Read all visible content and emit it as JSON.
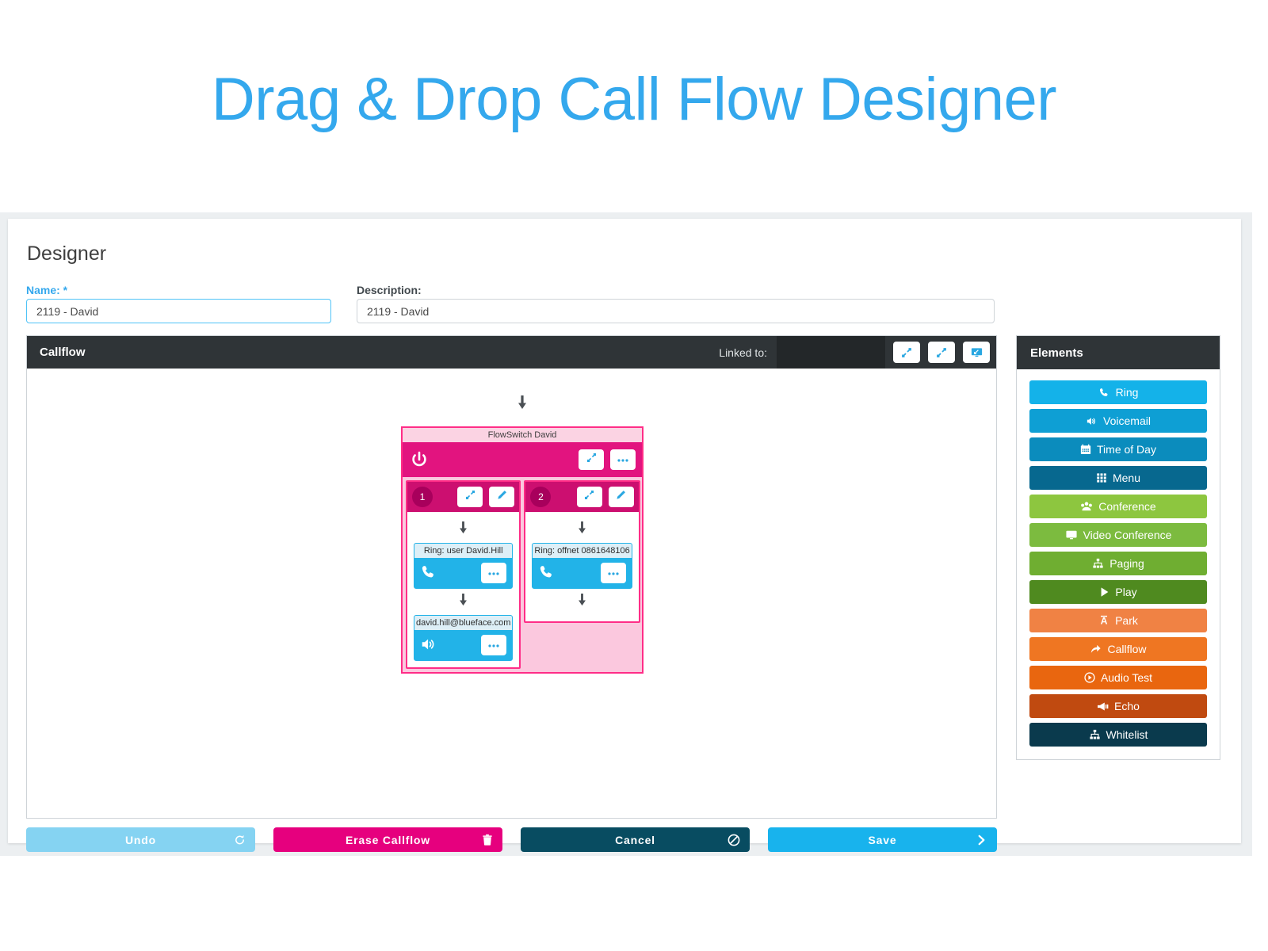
{
  "page": {
    "title": "Drag & Drop Call Flow Designer",
    "title_color": "#34a8ed"
  },
  "designer": {
    "heading": "Designer",
    "name_label": "Name: *",
    "name_value": "2119 - David",
    "name_placeholder": "Name",
    "description_label": "Description:",
    "description_value": "2119 - David",
    "description_placeholder": "Description"
  },
  "callflow_panel": {
    "title": "Callflow",
    "linked_to_label": "Linked to:",
    "linked_to_value": "",
    "buttons": [
      {
        "name": "collapse-button",
        "icon": "collapse-icon"
      },
      {
        "name": "expand-button",
        "icon": "expand-icon"
      },
      {
        "name": "screen-button",
        "icon": "monitor-icon"
      }
    ]
  },
  "flow": {
    "entry_arrow": "arrow-down-icon",
    "flowswitch": {
      "title": "FlowSwitch David",
      "icon": "power-icon",
      "collapse_icon": "collapse-icon",
      "more_icon": "ellipsis-icon",
      "branches": [
        {
          "number": "1",
          "collapse_icon": "collapse-icon",
          "edit_icon": "pencil-icon",
          "nodes": [
            {
              "label": "Ring: user David.Hill",
              "icon": "phone-icon",
              "more_icon": "ellipsis-icon"
            },
            {
              "label": "david.hill@blueface.com",
              "icon": "speaker-icon",
              "more_icon": "ellipsis-icon"
            }
          ]
        },
        {
          "number": "2",
          "collapse_icon": "collapse-icon",
          "edit_icon": "pencil-icon",
          "nodes": [
            {
              "label": "Ring: offnet 0861648106",
              "icon": "phone-icon",
              "more_icon": "ellipsis-icon"
            }
          ]
        }
      ]
    }
  },
  "elements": {
    "title": "Elements",
    "items": [
      {
        "label": "Ring",
        "icon": "phone-icon",
        "color": "#14b2e9"
      },
      {
        "label": "Voicemail",
        "icon": "speaker-icon",
        "color": "#0e9fd4"
      },
      {
        "label": "Time of Day",
        "icon": "calendar-icon",
        "color": "#0b8cbd"
      },
      {
        "label": "Menu",
        "icon": "grid-icon",
        "color": "#07688f"
      },
      {
        "label": "Conference",
        "icon": "conference-icon",
        "color": "#8dc63f"
      },
      {
        "label": "Video Conference",
        "icon": "monitor-icon",
        "color": "#7cbb3f"
      },
      {
        "label": "Paging",
        "icon": "sitemap-icon",
        "color": "#6fae31"
      },
      {
        "label": "Play",
        "icon": "play-icon",
        "color": "#4f8a1f"
      },
      {
        "label": "Park",
        "icon": "park-icon",
        "color": "#f08244"
      },
      {
        "label": "Callflow",
        "icon": "share-arrow-icon",
        "color": "#ef7622"
      },
      {
        "label": "Audio Test",
        "icon": "play-circle-icon",
        "color": "#e9660f"
      },
      {
        "label": "Echo",
        "icon": "megaphone-icon",
        "color": "#c04a10"
      },
      {
        "label": "Whitelist",
        "icon": "sitemap-icon",
        "color": "#0a3a4d"
      }
    ]
  },
  "footer": {
    "undo": {
      "label": "Undo",
      "icon": "refresh-icon",
      "color": "#85d3f2"
    },
    "erase": {
      "label": "Erase Callflow",
      "icon": "trash-icon",
      "color": "#e6007e"
    },
    "cancel": {
      "label": "Cancel",
      "icon": "ban-icon",
      "color": "#084c61"
    },
    "save": {
      "label": "Save",
      "icon": "chevron-right-icon",
      "color": "#18b3ed"
    }
  }
}
